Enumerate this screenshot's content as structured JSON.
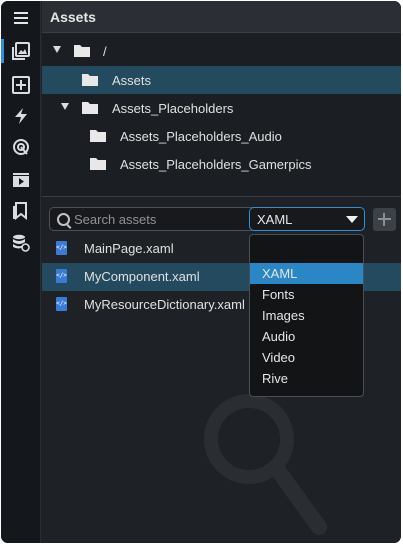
{
  "panel": {
    "title": "Assets"
  },
  "rail": {
    "items": [
      {
        "name": "menu-icon"
      },
      {
        "name": "assets-icon"
      },
      {
        "name": "add-panel-icon"
      },
      {
        "name": "lightning-icon"
      },
      {
        "name": "target-icon"
      },
      {
        "name": "media-icon"
      },
      {
        "name": "bookmarks-icon"
      },
      {
        "name": "database-link-icon"
      }
    ]
  },
  "tree": {
    "items": [
      {
        "label": "/",
        "expanded": true
      },
      {
        "label": "Assets",
        "selected": true
      },
      {
        "label": "Assets_Placeholders",
        "expanded": true
      },
      {
        "label": "Assets_Placeholders_Audio"
      },
      {
        "label": "Assets_Placeholders_Gamerpics"
      }
    ]
  },
  "search": {
    "placeholder": "Search assets",
    "value": ""
  },
  "type_filter": {
    "selected": "XAML",
    "options": [
      "",
      "XAML",
      "Fonts",
      "Images",
      "Audio",
      "Video",
      "Rive"
    ]
  },
  "files": [
    {
      "label": "MainPage.xaml"
    },
    {
      "label": "MyComponent.xaml",
      "selected": true
    },
    {
      "label": "MyResourceDictionary.xaml"
    }
  ],
  "colors": {
    "accent": "#2f8fd8",
    "selection": "#234a5e",
    "dropdown_active": "#2b86c6",
    "background": "#1e2125"
  }
}
